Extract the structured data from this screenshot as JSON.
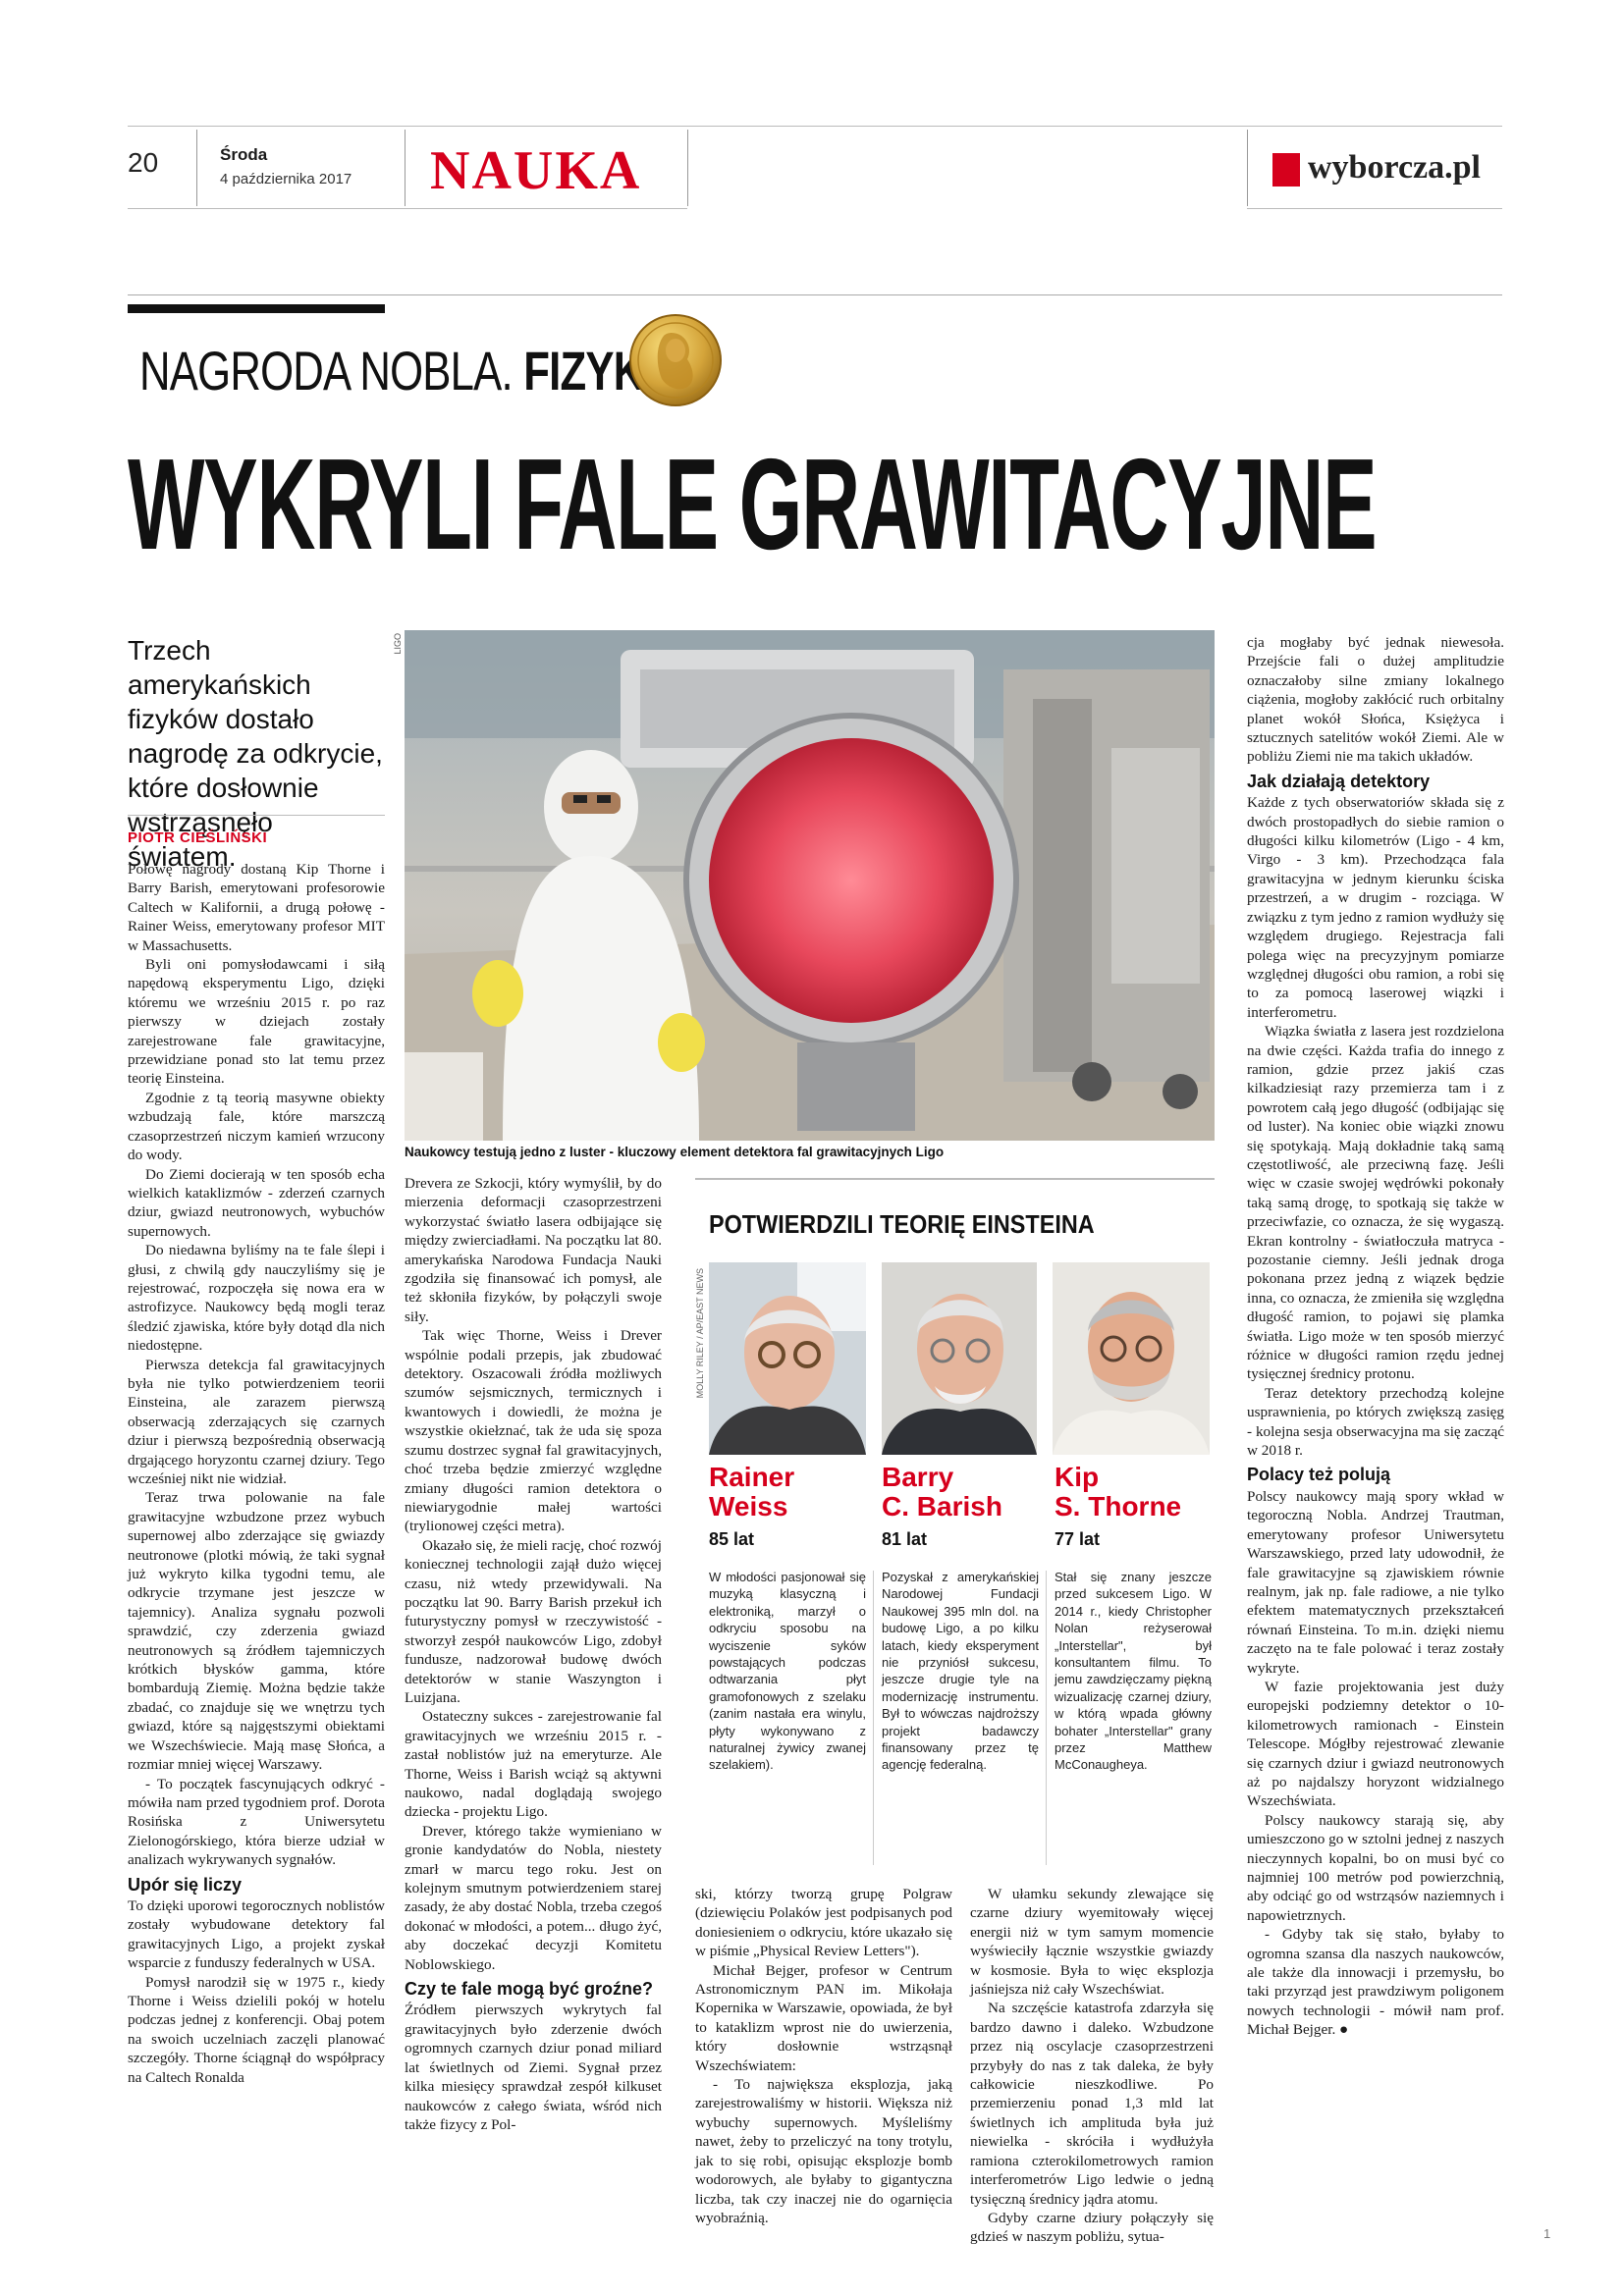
{
  "header": {
    "page_number": "20",
    "day": "Środa",
    "date": "4 października 2017",
    "section": "NAUKA",
    "logo": "wyborcza.pl"
  },
  "kicker": {
    "part1": "NAGRODA NOBLA.",
    "part2": "FIZYKA"
  },
  "headline": "WYKRYLI FALE GRAWITACYJNE",
  "lead": "Trzech amerykańskich fizyków dostało nagrodę za odkrycie, które dosłownie wstrząsnęło światem.",
  "byline": "PIOTR CIEŚLIŃSKI",
  "photo": {
    "credit": "LIGO",
    "caption": "Naukowcy testują jedno z luster - kluczowy element detektora fal grawitacyjnych Ligo"
  },
  "col1": [
    "Połowę nagrody dostaną Kip Thorne i Barry Barish, emerytowani profesorowie Caltech w Kalifornii, a drugą połowę - Rainer Weiss, emerytowany profesor MIT w Massachusetts.",
    "Byli oni pomysłodawcami i siłą napędową eksperymentu Ligo, dzięki któremu we wrześniu 2015 r. po raz pierwszy w dziejach zostały zarejestrowane fale grawitacyjne, przewidziane ponad sto lat temu przez teorię Einsteina.",
    "Zgodnie z tą teorią masywne obiekty wzbudzają fale, które marszczą czasoprzestrzeń niczym kamień wrzucony do wody.",
    "Do Ziemi docierają w ten sposób echa wielkich kataklizmów - zderzeń czarnych dziur, gwiazd neutronowych, wybuchów supernowych.",
    "Do niedawna byliśmy na te fale ślepi i głusi, z chwilą gdy nauczyliśmy się je rejestrować, rozpoczęła się nowa era w astrofizyce. Naukowcy będą mogli teraz śledzić zjawiska, które były dotąd dla nich niedostępne.",
    "Pierwsza detekcja fal grawitacyjnych była nie tylko potwierdzeniem teorii Einsteina, ale zarazem pierwszą obserwacją zderzających się czarnych dziur i pierwszą bezpośrednią obserwacją drgającego horyzontu czarnej dziury. Tego wcześniej nikt nie widział.",
    "Teraz trwa polowanie na fale grawitacyjne wzbudzone przez wybuch supernowej albo zderzające się gwiazdy neutronowe (plotki mówią, że taki sygnał już wykryto kilka tygodni temu, ale odkrycie trzymane jest jeszcze w tajemnicy). Analiza sygnału pozwoli sprawdzić, czy zderzenia gwiazd neutronowych są źródłem tajemniczych krótkich błysków gamma, które bombardują Ziemię. Można będzie także zbadać, co znajduje się we wnętrzu tych gwiazd, które są najgęstszymi obiektami we Wszechświecie. Mają masę Słońca, a rozmiar mniej więcej Warszawy.",
    "- To początek fascynujących odkryć - mówiła nam przed tygodniem prof. Dorota Rosińska z Uniwersytetu Zielonogórskiego, która bierze udział w analizach wykrywanych sygnałów."
  ],
  "col1_h": "Upór się liczy",
  "col1b": [
    "To dzięki uporowi tegorocznych noblistów zostały wybudowane detektory fal grawitacyjnych Ligo, a projekt zyskał wsparcie z funduszy federalnych w USA.",
    "Pomysł narodził się w 1975 r., kiedy Thorne i Weiss dzielili pokój w hotelu podczas jednej z konferencji. Obaj potem na swoich uczelniach zaczęli planować szczegóły. Thorne ściągnął do współpracy na Caltech Ronalda"
  ],
  "col2": [
    "Drevera ze Szkocji, który wymyślił, by do mierzenia deformacji czasoprzestrzeni wykorzystać światło lasera odbijające się między zwierciadłami. Na początku lat 80. amerykańska Narodowa Fundacja Nauki zgodziła się finansować ich pomysł, ale też skłoniła fizyków, by połączyli swoje siły.",
    "Tak więc Thorne, Weiss i Drever wspólnie podali przepis, jak zbudować detektory. Oszacowali źródła możliwych szumów sejsmicznych, termicznych i kwantowych i dowiedli, że można je wszystkie okiełznać, tak że uda się spoza szumu dostrzec sygnał fal grawitacyjnych, choć trzeba będzie zmierzyć względne zmiany długości ramion detektora o niewiarygodnie małej wartości (trylionowej części metra).",
    "Okazało się, że mieli rację, choć rozwój koniecznej technologii zajął dużo więcej czasu, niż wtedy przewidywali. Na początku lat 90. Barry Barish przekuł ich futurystyczny pomysł w rzeczywistość - stworzył zespół naukowców Ligo, zdobył fundusze, nadzorował budowę dwóch detektorów w stanie Waszyngton i Luizjana.",
    "Ostateczny sukces - zarejestrowanie fal grawitacyjnych we wrześniu 2015 r. - zastał noblistów już na emeryturze. Ale Thorne, Weiss i Barish wciąż są aktywni naukowo, nadal doglądają swojego dziecka - projektu Ligo.",
    "Drever, którego także wymieniano w gronie kandydatów do Nobla, niestety zmarł w marcu tego roku. Jest on kolejnym smutnym potwierdzeniem starej zasady, że aby dostać Nobla, trzeba czegoś dokonać w młodości, a potem... długo żyć, aby doczekać decyzji Komitetu Noblowskiego."
  ],
  "col2_h": "Czy te fale mogą być groźne?",
  "col2b": [
    "Źródłem pierwszych wykrytych fal grawitacyjnych było zderzenie dwóch ogromnych czarnych dziur ponad miliard lat świetlnych od Ziemi. Sygnał przez kilka miesięcy sprawdzał zespół kilkuset naukowców z całego świata, wśród nich także fizycy z Pol-"
  ],
  "col3": [
    "ski, którzy tworzą grupę Polgraw (dziewięciu Polaków jest podpisanych pod doniesieniem o odkryciu, które ukazało się w piśmie „Physical Review Letters\").",
    "Michał Bejger, profesor w Centrum Astronomicznym PAN im. Mikołaja Kopernika w Warszawie, opowiada, że był to kataklizm wprost nie do uwierzenia, który dosłownie wstrząsnął Wszechświatem:",
    "- To największa eksplozja, jaką zarejestrowaliśmy w historii. Większa niż wybuchy supernowych. Myśleliśmy nawet, żeby to przeliczyć na tony trotylu, jak to się robi, opisując eksplozje bomb wodorowych, ale byłaby to gigantyczna liczba, tak czy inaczej nie do ogarnięcia wyobraźnią."
  ],
  "col4": [
    "W ułamku sekundy zlewające się czarne dziury wyemitowały więcej energii niż w tym samym momencie wyświeciły łącznie wszystkie gwiazdy w kosmosie. Była to więc eksplozja jaśniejsza niż cały Wszechświat.",
    "Na szczęście katastrofa zdarzyła się bardzo dawno i daleko. Wzbudzone przez nią oscylacje czasoprzestrzeni przybyły do nas z tak daleka, że były całkowicie nieszkodliwe. Po przemierzeniu ponad 1,3 mld lat świetlnych ich amplituda była już niewielka - skróciła i wydłużyła ramiona czterokilometrowych ramion interferometrów Ligo ledwie o jedną tysięczną średnicy jądra atomu.",
    "Gdyby czarne dziury połączyły się gdzieś w naszym pobliżu, sytua-"
  ],
  "col5": [
    "cja mogłaby być jednak niewesoła. Przejście fali o dużej amplitudzie oznaczałoby silne zmiany lokalnego ciążenia, mogłoby zakłócić ruch orbitalny planet wokół Słońca, Księżyca i sztucznych satelitów wokół Ziemi. Ale w pobliżu Ziemi nie ma takich układów."
  ],
  "col5_h1": "Jak działają detektory",
  "col5b": [
    "Każde z tych obserwatoriów składa się z dwóch prostopadłych do siebie ramion o długości kilku kilometrów (Ligo - 4 km, Virgo - 3 km). Przechodząca fala grawitacyjna w jednym kierunku ściska przestrzeń, a w drugim - rozciąga. W związku z tym jedno z ramion wydłuży się względem drugiego. Rejestracja fali polega więc na precyzyjnym pomiarze względnej długości obu ramion, a robi się to za pomocą laserowej wiązki i interferometru.",
    "Wiązka światła z lasera jest rozdzielona na dwie części. Każda trafia do innego z ramion, gdzie przez jakiś czas kilkadziesiąt razy przemierza tam i z powrotem całą jego długość (odbijając się od luster). Na koniec obie wiązki znowu się spotykają. Mają dokładnie taką samą częstotliwość, ale przeciwną fazę. Jeśli więc w czasie swojej wędrówki pokonały taką samą drogę, to spotkają się także w przeciwfazie, co oznacza, że się wygaszą. Ekran kontrolny - światłoczuła matryca - pozostanie ciemny. Jeśli jednak droga pokonana przez jedną z wiązek będzie inna, co oznacza, że zmieniła się względna długość ramion, to pojawi się plamka światła. Ligo może w ten sposób mierzyć różnice w długości ramion rzędu jednej tysięcznej średnicy protonu.",
    "Teraz detektory przechodzą kolejne usprawnienia, po których zwiększą zasięg - kolejna sesja obserwacyjna ma się zacząć w 2018 r."
  ],
  "col5_h2": "Polacy też polują",
  "col5c": [
    "Polscy naukowcy mają spory wkład w tegoroczną Nobla. Andrzej Trautman, emerytowany profesor Uniwersytetu Warszawskiego, przed laty udowodnił, że fale grawitacyjne są zjawiskiem równie realnym, jak np. fale radiowe, a nie tylko efektem matematycznych przekształceń równań Einsteina. To m.in. dzięki niemu zaczęto na te fale polować i teraz zostały wykryte.",
    "W fazie projektowania jest duży europejski podziemny detektor o 10-kilometrowych ramionach - Einstein Telescope. Mógłby rejestrować zlewanie się czarnych dziur i gwiazd neutronowych aż po najdalszy horyzont widzialnego Wszechświata.",
    "Polscy naukowcy starają się, aby umieszczono go w sztolni jednej z naszych nieczynnych kopalni, bo on musi być co najmniej 100 metrów pod powierzchnią, aby odciąć go od wstrząsów naziemnych i napowietrznych.",
    "- Gdyby tak się stało, byłaby to ogromna szansa dla naszych naukowców, ale także dla innowacji i przemysłu, bo taki przyrząd jest prawdziwym poligonem nowych technologii - mówił nam prof. Michał Bejger. ●"
  ],
  "box": {
    "title": "POTWIERDZILI TEORIĘ EINSTEINA",
    "credit": "MOLLY RILEY / AP/EAST NEWS",
    "people": [
      {
        "name1": "Rainer",
        "name2": "Weiss",
        "age": "85 lat",
        "bio": "W młodości pasjonował się muzyką klasyczną i elektroniką, marzył o odkryciu sposobu na wyciszenie syków powstających podczas odtwarzania płyt gramofonowych z szelaku (zanim nastała era winylu, płyty wykonywano z naturalnej żywicy zwanej szelakiem)."
      },
      {
        "name1": "Barry",
        "name2": "C. Barish",
        "age": "81 lat",
        "bio": "Pozyskał z amerykańskiej Narodowej Fundacji Naukowej 395 mln dol. na budowę Ligo, a po kilku latach, kiedy eksperyment nie przyniósł sukcesu, jeszcze drugie tyle na modernizację instrumentu. Był to wówczas najdroższy projekt badawczy finansowany przez tę agencję federalną."
      },
      {
        "name1": "Kip",
        "name2": "S. Thorne",
        "age": "77 lat",
        "bio": "Stał się znany jeszcze przed sukcesem Ligo. W 2014 r., kiedy Christopher Nolan reżyserował „Interstellar\", był konsultantem filmu. To jemu zawdzięczamy piękną wizualizację czarnej dziury, w którą wpada główny bohater „Interstellar\" grany przez Matthew McConaugheya."
      }
    ]
  },
  "footer_number": "1",
  "colors": {
    "accent": "#d6001c"
  }
}
